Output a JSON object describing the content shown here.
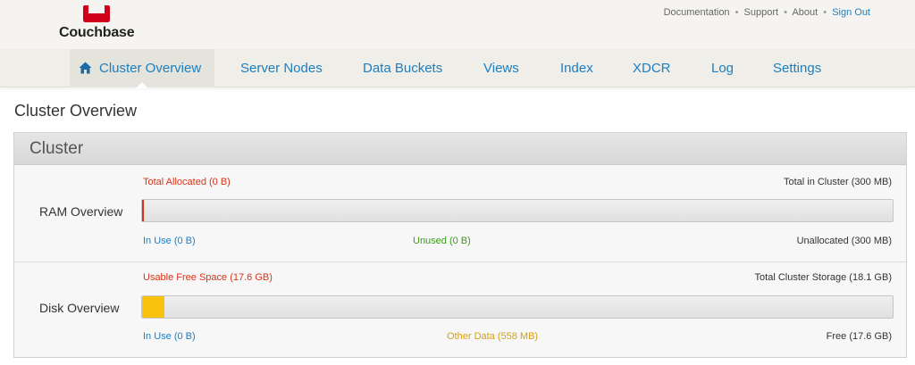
{
  "brand": {
    "name": "Couchbase",
    "color": "#d0021b"
  },
  "top_links": {
    "documentation": "Documentation",
    "support": "Support",
    "about": "About",
    "sign_out": "Sign Out",
    "separator": "•"
  },
  "nav": {
    "items": [
      {
        "label": "Cluster Overview",
        "icon": "home-icon",
        "active": true
      },
      {
        "label": "Server Nodes"
      },
      {
        "label": "Data Buckets"
      },
      {
        "label": "Views"
      },
      {
        "label": "Index"
      },
      {
        "label": "XDCR"
      },
      {
        "label": "Log"
      },
      {
        "label": "Settings"
      }
    ]
  },
  "page": {
    "title": "Cluster Overview"
  },
  "cluster": {
    "title": "Cluster",
    "ram": {
      "label": "RAM Overview",
      "total_allocated": "Total Allocated (0 B)",
      "total_in_cluster": "Total in Cluster (300 MB)",
      "in_use": "In Use (0 B)",
      "unused": "Unused (0 B)",
      "unallocated": "Unallocated (300 MB)",
      "used_fraction": 0.0
    },
    "disk": {
      "label": "Disk Overview",
      "usable_free_space": "Usable Free Space (17.6 GB)",
      "total_cluster_storage": "Total Cluster Storage (18.1 GB)",
      "in_use": "In Use (0 B)",
      "other_data": "Other Data (558 MB)",
      "free": "Free (17.6 GB)",
      "other_data_fraction": 0.03
    }
  },
  "colors": {
    "link": "#1c7fc1",
    "allocated": "#d4341b",
    "unused": "#3b9a1b",
    "other_data": "#d4a017",
    "other_data_bar": "#f7c10d"
  }
}
